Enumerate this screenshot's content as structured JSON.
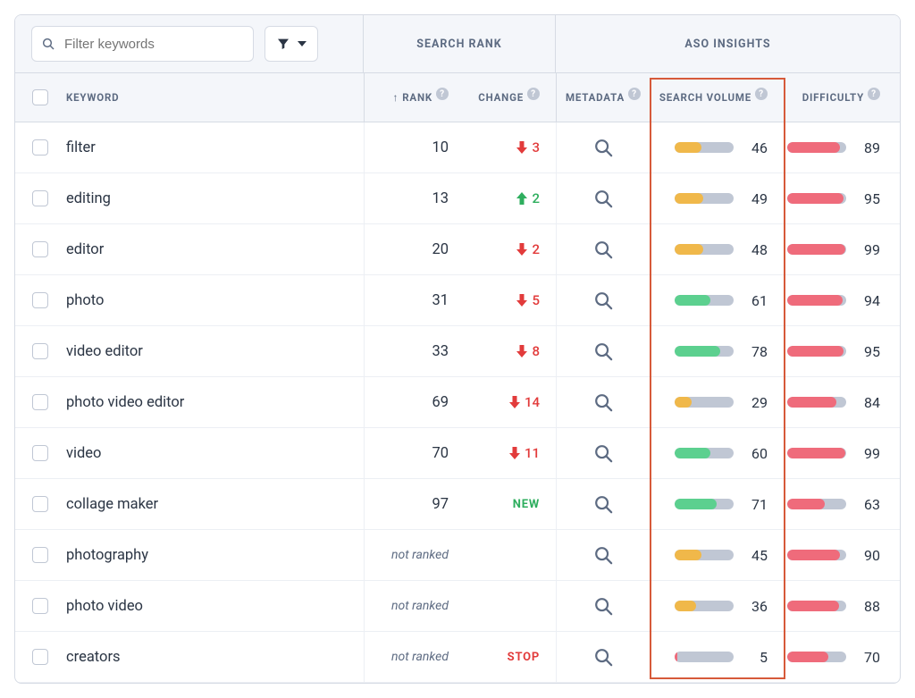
{
  "filter": {
    "placeholder": "Filter keywords"
  },
  "groups": {
    "search_rank": "SEARCH RANK",
    "aso_insights": "ASO INSIGHTS"
  },
  "columns": {
    "keyword": "KEYWORD",
    "rank": "RANK",
    "change": "CHANGE",
    "metadata": "METADATA",
    "search_volume": "SEARCH VOLUME",
    "difficulty": "DIFFICULTY"
  },
  "labels": {
    "not_ranked": "not ranked",
    "new": "NEW",
    "stop": "STOP"
  },
  "rows": [
    {
      "keyword": "filter",
      "rank": "10",
      "change_dir": "down",
      "change_val": "3",
      "sv": 46,
      "diff": 89
    },
    {
      "keyword": "editing",
      "rank": "13",
      "change_dir": "up",
      "change_val": "2",
      "sv": 49,
      "diff": 95
    },
    {
      "keyword": "editor",
      "rank": "20",
      "change_dir": "down",
      "change_val": "2",
      "sv": 48,
      "diff": 99
    },
    {
      "keyword": "photo",
      "rank": "31",
      "change_dir": "down",
      "change_val": "5",
      "sv": 61,
      "diff": 94
    },
    {
      "keyword": "video editor",
      "rank": "33",
      "change_dir": "down",
      "change_val": "8",
      "sv": 78,
      "diff": 95
    },
    {
      "keyword": "photo video editor",
      "rank": "69",
      "change_dir": "down",
      "change_val": "14",
      "sv": 29,
      "diff": 84
    },
    {
      "keyword": "video",
      "rank": "70",
      "change_dir": "down",
      "change_val": "11",
      "sv": 60,
      "diff": 99
    },
    {
      "keyword": "collage maker",
      "rank": "97",
      "change_dir": "new",
      "change_val": "",
      "sv": 71,
      "diff": 63
    },
    {
      "keyword": "photography",
      "rank": "not_ranked",
      "change_dir": "none",
      "change_val": "",
      "sv": 45,
      "diff": 90
    },
    {
      "keyword": "photo video",
      "rank": "not_ranked",
      "change_dir": "none",
      "change_val": "",
      "sv": 36,
      "diff": 88
    },
    {
      "keyword": "creators",
      "rank": "not_ranked",
      "change_dir": "stop",
      "change_val": "",
      "sv": 5,
      "diff": 70
    }
  ]
}
